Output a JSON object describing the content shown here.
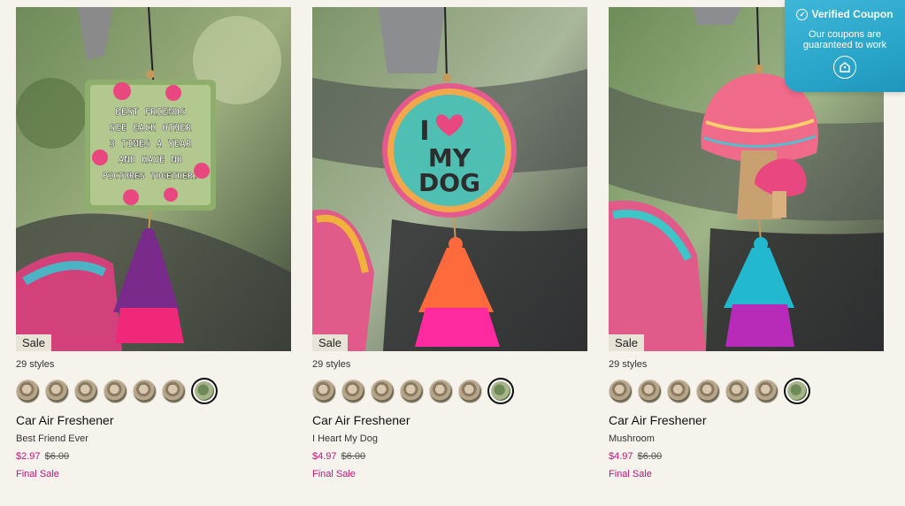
{
  "products": [
    {
      "badge": "Sale",
      "styles_count": "29 styles",
      "name": "Car Air Freshener",
      "style": "Best Friend Ever",
      "price_sale": "$2.97",
      "price_original": "$6.00",
      "final_sale": "Final Sale",
      "image_text": [
        "BEST FRIENDS",
        "SEE EACH OTHER",
        "3 TIMES A YEAR",
        "AND HAVE NO",
        "PICTURES TOGETHER."
      ]
    },
    {
      "badge": "Sale",
      "styles_count": "29 styles",
      "name": "Car Air Freshener",
      "style": "I Heart My Dog",
      "price_sale": "$4.97",
      "price_original": "$6.00",
      "final_sale": "Final Sale",
      "image_text": [
        "I",
        "MY",
        "DOG"
      ]
    },
    {
      "badge": "Sale",
      "styles_count": "29 styles",
      "name": "Car Air Freshener",
      "style": "Mushroom",
      "price_sale": "$4.97",
      "price_original": "$6.00",
      "final_sale": "Final Sale",
      "image_text": []
    }
  ],
  "coupon": {
    "title": "Verified Coupon",
    "subtitle": "Our coupons are guaranteed to work",
    "icon": "coupon-tag-icon"
  },
  "colors": {
    "sale_price": "#c0157a",
    "coupon_bg": "#2aa6c9"
  }
}
